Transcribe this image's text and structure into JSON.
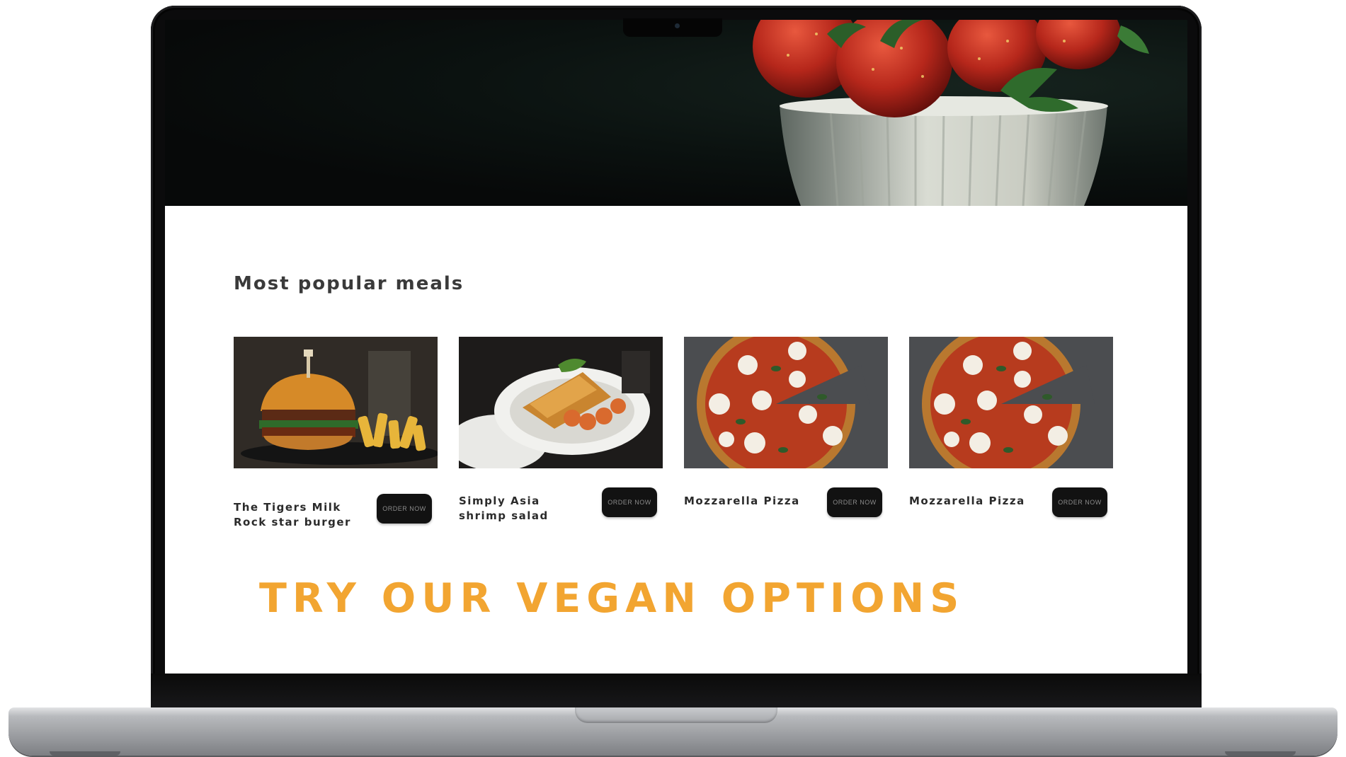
{
  "page": {
    "section_title": "Most popular meals",
    "vegan_heading": "TRY OUR VEGAN OPTIONS"
  },
  "meals": [
    {
      "name": "The Tigers Milk Rock star burger",
      "button": "ORDER NOW",
      "image": "burger-photo"
    },
    {
      "name": "Simply Asia shrimp salad",
      "button": "ORDER NOW",
      "image": "shrimp-plate-photo"
    },
    {
      "name": "Mozzarella Pizza",
      "button": "ORDER NOW",
      "image": "pizza-photo"
    },
    {
      "name": "Mozzarella Pizza",
      "button": "ORDER NOW",
      "image": "pizza-photo"
    }
  ],
  "colors": {
    "accent": "#f2a531",
    "button_bg": "#121212",
    "hero_bg": "#0b1210"
  }
}
